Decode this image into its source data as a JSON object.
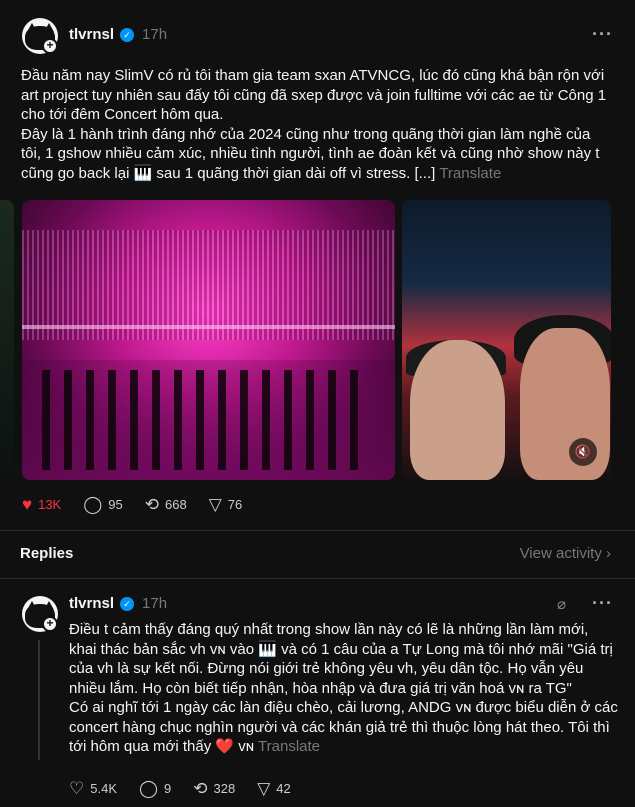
{
  "post": {
    "username": "tlvrnsl",
    "verified_mark": "✓",
    "time": "17h",
    "more_label": "···",
    "body_line1": "Đầu năm nay SlimV có rủ tôi tham gia team sxan ATVNCG, lúc đó cũng khá bận rộn với",
    "body_line2": "art project tuy nhiên sau đấy tôi cũng đã sxep được và join fulltime với các ae từ Công 1",
    "body_line3": "cho tới đêm Concert hôm qua.",
    "body_line4": "Đây là 1 hành trình đáng nhớ của 2024 cũng như trong quãng thời gian làm nghề của",
    "body_line5": "tôi, 1 gshow nhiều cảm xúc, nhiều tình người, tình ae đoàn kết và cũng nhờ show này t",
    "body_line6": "cũng go back lại 🎹 sau 1 quãng thời gian dài off vì stress. [...]",
    "translate": "Translate",
    "likes": "13K",
    "comments": "95",
    "reposts": "668",
    "shares": "76"
  },
  "replies_section": {
    "title": "Replies",
    "view_activity": "View activity ›"
  },
  "reply": {
    "username": "tlvrnsl",
    "verified_mark": "✓",
    "time": "17h",
    "more_label": "···",
    "line1": "Điều t cảm thấy đáng quý nhất trong show lần này có lẽ là những lần làm mới,",
    "line2": "khai thác bản sắc vh ᴠɴ vào 🎹 và có 1 câu của a Tự Long mà tôi nhớ mãi \"Giá trị",
    "line3": "của vh là sự kết nối. Đừng nói giới trẻ không yêu vh, yêu dân tộc. Họ vẫn yêu",
    "line4": "nhiều lắm. Họ còn biết tiếp nhận, hòa nhập và đưa giá trị văn hoá ᴠɴ ra TG\"",
    "line5": "Có ai nghĩ tới 1 ngày các làn điệu chèo, cải lương, ANDG ᴠɴ được biểu diễn ở các",
    "line6": "concert hàng chục nghìn người và các khán giả trẻ thì thuộc lòng hát theo. Tôi thì",
    "line7": "tới hôm qua mới thấy ❤️ ᴠɴ",
    "translate": "Translate",
    "likes": "5.4K",
    "comments": "9",
    "reposts": "328",
    "shares": "42"
  },
  "icons": {
    "heart_filled": "♥",
    "heart_outline": "♡",
    "comment": "◯",
    "repost": "⟲",
    "share": "▽",
    "mute": "🔇",
    "plus": "+",
    "edit": "⌀"
  },
  "colors": {
    "background": "#101010",
    "like_red": "#ff3040",
    "verified_blue": "#0095f6",
    "muted_text": "#777777"
  }
}
